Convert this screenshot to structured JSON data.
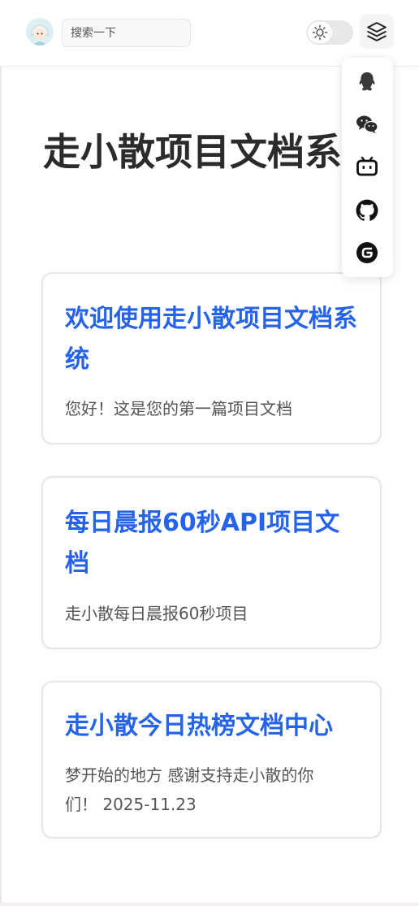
{
  "header": {
    "avatar_alt": "avatar",
    "search_placeholder": "搜索一下"
  },
  "social_menu": [
    {
      "name": "qq",
      "icon": "qq-icon"
    },
    {
      "name": "wechat",
      "icon": "wechat-icon"
    },
    {
      "name": "bilibili",
      "icon": "bilibili-icon"
    },
    {
      "name": "github",
      "icon": "github-icon"
    },
    {
      "name": "gitee",
      "icon": "gitee-icon"
    }
  ],
  "main": {
    "title": "走小散项目文档系统",
    "cards": [
      {
        "title": "欢迎使用走小散项目文档系统",
        "desc": "您好！这是您的第一篇项目文档"
      },
      {
        "title": "每日晨报60秒API项目文档",
        "desc": "走小散每日晨报60秒项目"
      },
      {
        "title": "走小散今日热榜文档中心",
        "desc": "梦开始的地方 感谢支持走小散的你们！ 2025-11.23"
      }
    ]
  },
  "colors": {
    "accent": "#2563eb",
    "title_text": "#2b2b2b",
    "desc_text": "#555555"
  }
}
